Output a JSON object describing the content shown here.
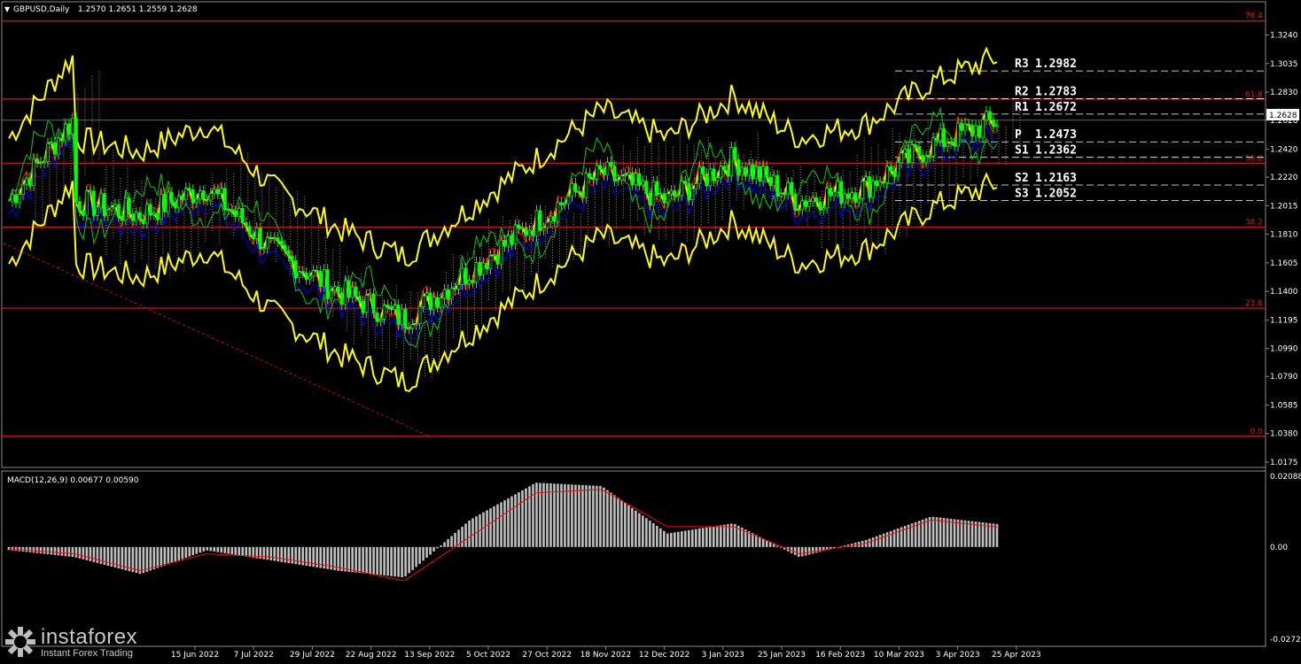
{
  "header": {
    "symbol": "GBPUSD,Daily",
    "ohlc": "1.2570 1.2651 1.2559 1.2628"
  },
  "colors": {
    "background": "#000000",
    "bull_candle": "#00ff00",
    "bear_candle": "#00ff00",
    "bollinger": "#ffff00",
    "tenkan": "#ff0000",
    "kijun": "#0000ff",
    "chikou": "#00cc00",
    "kumo": "#d8b0a0",
    "fib_level": "#e01818",
    "pivot_line": "#ffffff",
    "macd_hist": "#c0c0c0",
    "macd_signal": "#ff0000"
  },
  "price_axis": {
    "ticks": [
      "1.3240",
      "1.3035",
      "1.2830",
      "1.2628",
      "1.2420",
      "1.2220",
      "1.2015",
      "1.1810",
      "1.1605",
      "1.1400",
      "1.1195",
      "1.0990",
      "1.0790",
      "1.0585",
      "1.0380",
      "1.0175"
    ],
    "current_price": "1.2628"
  },
  "time_axis": {
    "labels": [
      "15 Jun 2022",
      "7 Jul 2022",
      "29 Jul 2022",
      "22 Aug 2022",
      "13 Sep 2022",
      "5 Oct 2022",
      "27 Oct 2022",
      "18 Nov 2022",
      "12 Dec 2022",
      "3 Jan 2023",
      "25 Jan 2023",
      "16 Feb 2023",
      "10 Mar 2023",
      "3 Apr 2023",
      "25 Apr 2023"
    ]
  },
  "fib_levels": [
    {
      "label": "76.4",
      "price": 1.334
    },
    {
      "label": "61.8",
      "price": 1.278
    },
    {
      "label": "50.0",
      "price": 1.232
    },
    {
      "label": "38.2",
      "price": 1.186
    },
    {
      "label": "23.6",
      "price": 1.128
    },
    {
      "label": "0.0",
      "price": 1.036
    }
  ],
  "pivots": [
    {
      "label": "R3",
      "value": "1.2982",
      "price": 1.2982
    },
    {
      "label": "R2",
      "value": "1.2783",
      "price": 1.2783
    },
    {
      "label": "R1",
      "value": "1.2672",
      "price": 1.2672
    },
    {
      "label": "P",
      "value": "1.2473",
      "price": 1.2473
    },
    {
      "label": "S1",
      "value": "1.2362",
      "price": 1.2362
    },
    {
      "label": "S2",
      "value": "1.2163",
      "price": 1.2163
    },
    {
      "label": "S3",
      "value": "1.2052",
      "price": 1.2052
    }
  ],
  "macd": {
    "title": "MACD(12,26,9) 0.00677 0.00590",
    "ticks": [
      "0.02088",
      "0.00",
      "-0.02724"
    ]
  },
  "logo": {
    "main": "instaforex",
    "sub": "Instant Forex Trading"
  },
  "chart_data": {
    "type": "line",
    "title": "GBPUSD,Daily",
    "x": [
      "15 Jun 2022",
      "7 Jul 2022",
      "29 Jul 2022",
      "22 Aug 2022",
      "13 Sep 2022",
      "5 Oct 2022",
      "27 Oct 2022",
      "18 Nov 2022",
      "12 Dec 2022",
      "3 Jan 2023",
      "25 Jan 2023",
      "16 Feb 2023",
      "10 Mar 2023",
      "3 Apr 2023",
      "25 Apr 2023"
    ],
    "ylim": [
      1.0175,
      1.344
    ],
    "series": [
      {
        "name": "GBPUSD",
        "values": [
          1.205,
          1.195,
          1.215,
          1.17,
          1.14,
          1.12,
          1.155,
          1.19,
          1.225,
          1.205,
          1.235,
          1.205,
          1.215,
          1.245,
          1.2628
        ]
      }
    ],
    "macd_histogram": [
      -0.003,
      -0.008,
      -0.001,
      -0.004,
      -0.007,
      -0.009,
      0.008,
      0.019,
      0.018,
      0.004,
      0.007,
      -0.003,
      0.002,
      0.009,
      0.0068
    ],
    "macd_signal": [
      -0.002,
      -0.007,
      -0.002,
      -0.003,
      -0.006,
      -0.01,
      0.003,
      0.016,
      0.017,
      0.006,
      0.006,
      -0.002,
      0.001,
      0.008,
      0.0059
    ],
    "macd_ylim": [
      -0.02724,
      0.02088
    ]
  }
}
